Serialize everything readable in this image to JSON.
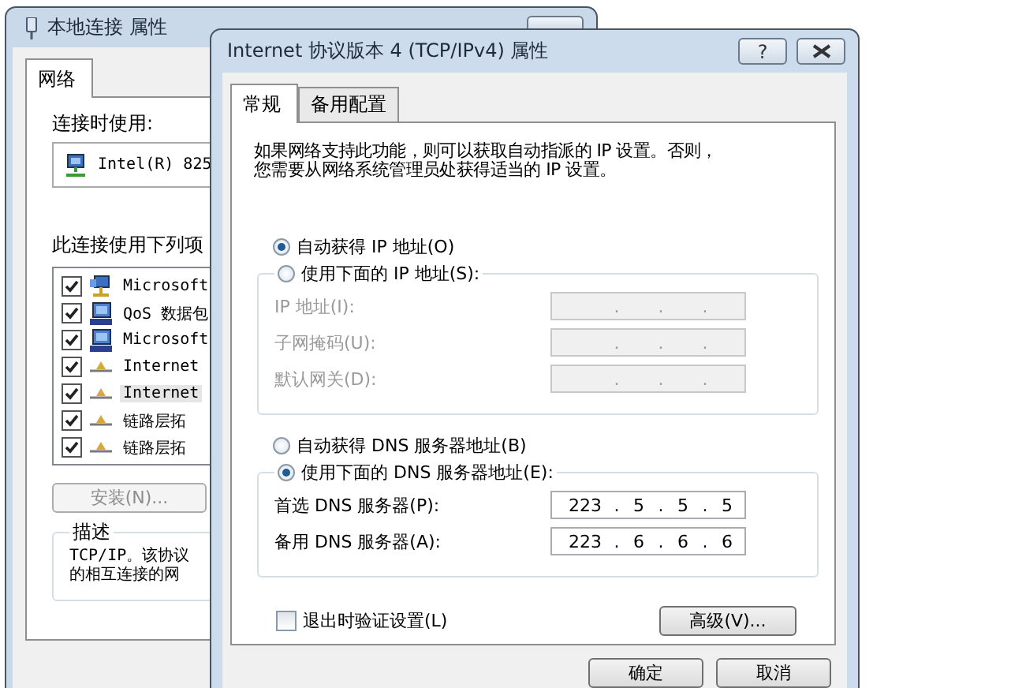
{
  "properties_window": {
    "title": "本地连接 属性",
    "tabs": [
      {
        "label": "网络",
        "selected": true
      }
    ],
    "connect_using_label": "连接时使用:",
    "adapter": "Intel(R) 825",
    "items_label": "此连接使用下列项",
    "items": [
      {
        "label": "Microsoft",
        "checked": true,
        "selected": false,
        "kind": "client"
      },
      {
        "label": "QoS 数据包",
        "checked": true,
        "selected": false,
        "kind": "service"
      },
      {
        "label": "Microsoft",
        "checked": true,
        "selected": false,
        "kind": "service"
      },
      {
        "label": "Internet",
        "checked": true,
        "selected": false,
        "kind": "protocol"
      },
      {
        "label": "Internet",
        "checked": true,
        "selected": true,
        "kind": "protocol"
      },
      {
        "label": "链路层拓",
        "checked": true,
        "selected": false,
        "kind": "protocol"
      },
      {
        "label": "链路层拓",
        "checked": true,
        "selected": false,
        "kind": "protocol"
      }
    ],
    "install_button": {
      "label": "安装(N)...",
      "disabled": true
    },
    "description": {
      "title": "描述",
      "lines": [
        "TCP/IP。该协议",
        "的相互连接的网"
      ]
    }
  },
  "dialog": {
    "title": "Internet 协议版本 4 (TCP/IPv4) 属性",
    "help_button": "?",
    "tabs": [
      {
        "label": "常规",
        "selected": true
      },
      {
        "label": "备用配置",
        "selected": false
      }
    ],
    "intro": [
      "如果网络支持此功能，则可以获取自动指派的 IP 设置。否则，",
      "您需要从网络系统管理员处获得适当的 IP 设置。"
    ],
    "ip_options": [
      {
        "label": "自动获得 IP 地址(O)",
        "selected": true
      },
      {
        "label": "使用下面的 IP 地址(S):",
        "selected": false
      }
    ],
    "ip_fields": [
      {
        "label": "IP 地址(I):",
        "disabled": true,
        "dots": [
          ".",
          ".",
          "."
        ]
      },
      {
        "label": "子网掩码(U):",
        "disabled": true,
        "dots": [
          ".",
          ".",
          "."
        ]
      },
      {
        "label": "默认网关(D):",
        "disabled": true,
        "dots": [
          ".",
          ".",
          "."
        ]
      }
    ],
    "dns_options": [
      {
        "label": "自动获得 DNS 服务器地址(B)",
        "selected": false
      },
      {
        "label": "使用下面的 DNS 服务器地址(E):",
        "selected": true
      }
    ],
    "dns_fields": [
      {
        "label": "首选 DNS 服务器(P):",
        "disabled": false,
        "octets": [
          "223",
          "5",
          "5",
          "5"
        ],
        "dots": [
          ".",
          ".",
          "."
        ]
      },
      {
        "label": "备用 DNS 服务器(A):",
        "disabled": false,
        "octets": [
          "223",
          "6",
          "6",
          "6"
        ],
        "dots": [
          ".",
          ".",
          "."
        ]
      }
    ],
    "validate_checkbox": {
      "label": "退出时验证设置(L)",
      "checked": false
    },
    "advanced_button": "高级(V)...",
    "buttons": [
      "确定",
      "取消"
    ]
  }
}
